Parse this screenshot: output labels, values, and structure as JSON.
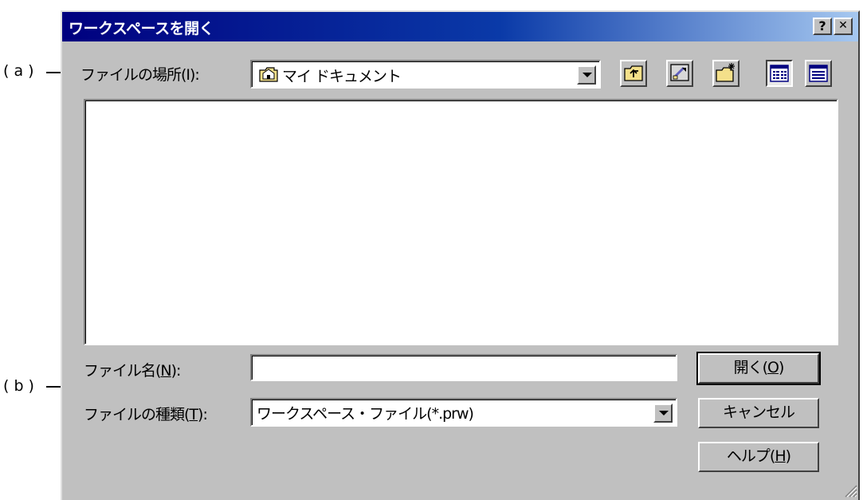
{
  "annotations": {
    "a": "( a )",
    "b": "( b )"
  },
  "dialog": {
    "title": "ワークスペースを開く",
    "help_button": "?",
    "close_button": "✕"
  },
  "look_in": {
    "label": "ファイルの場所(I):",
    "value": "マイ ドキュメント",
    "icon": "folder-icon"
  },
  "toolbar": {
    "buttons": [
      {
        "name": "up-one-level",
        "icon": "up-folder-icon"
      },
      {
        "name": "desktop",
        "icon": "desktop-icon"
      },
      {
        "name": "new-folder",
        "icon": "new-folder-icon"
      },
      {
        "name": "list-view",
        "icon": "list-view-icon",
        "pressed": true
      },
      {
        "name": "details-view",
        "icon": "details-view-icon"
      }
    ]
  },
  "filename": {
    "label_prefix": "ファイル名(",
    "label_key": "N",
    "label_suffix": "):",
    "value": ""
  },
  "filetype": {
    "label_prefix": "ファイルの種類(",
    "label_key": "T",
    "label_suffix": "):",
    "value": "ワークスペース・ファイル(*.prw)"
  },
  "buttons": {
    "open_prefix": "開く(",
    "open_key": "O",
    "open_suffix": ")",
    "cancel": "キャンセル",
    "help_prefix": "ヘルプ(",
    "help_key": "H",
    "help_suffix": ")"
  }
}
